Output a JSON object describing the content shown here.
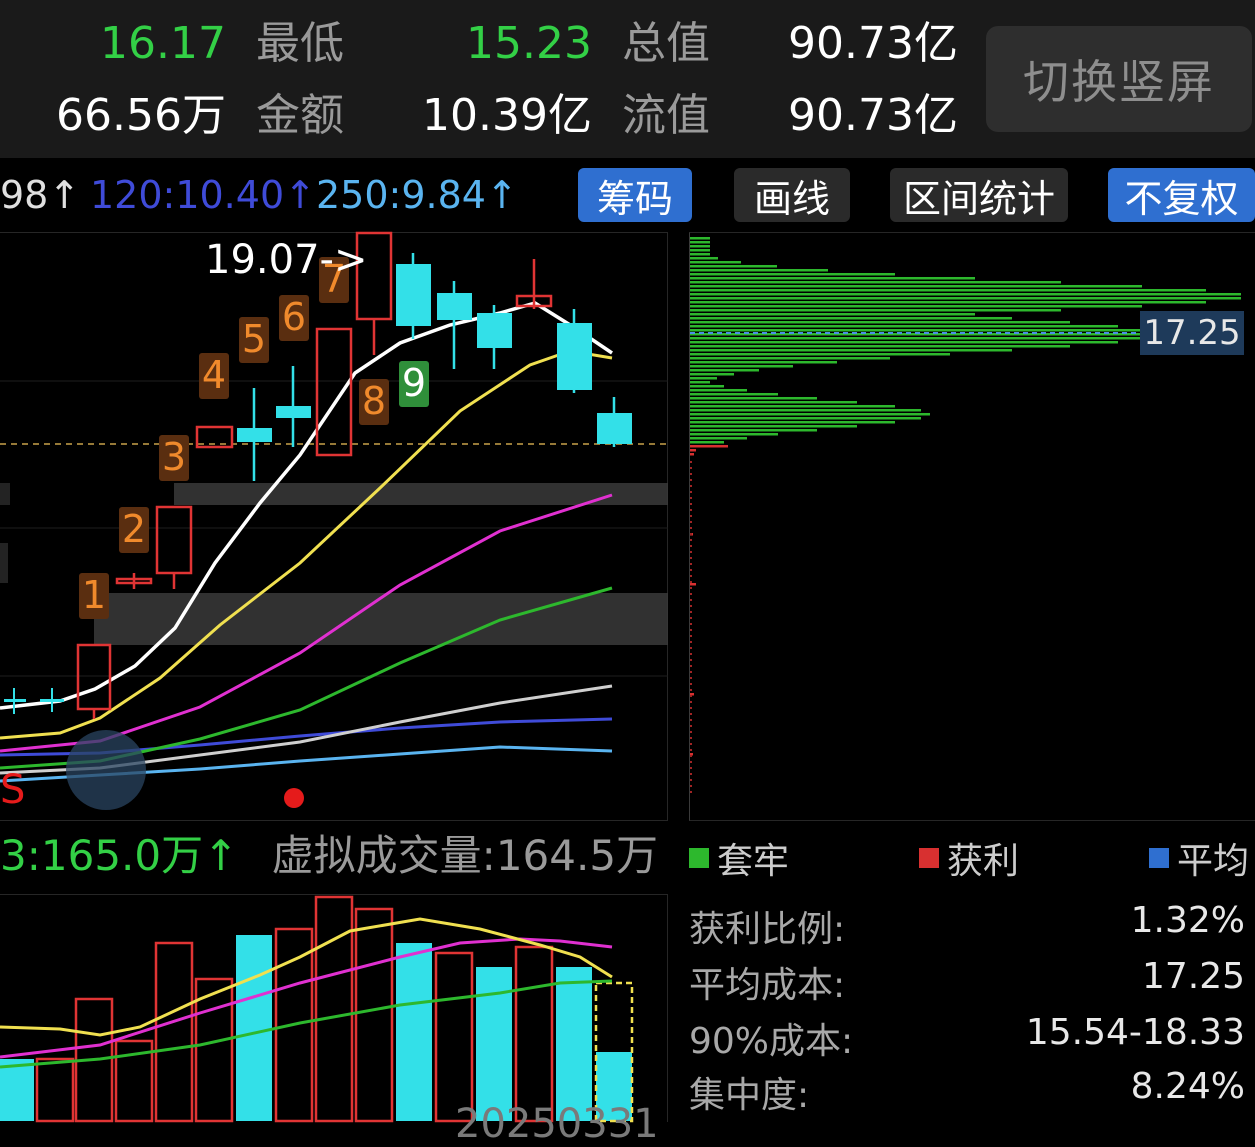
{
  "header": {
    "row1": [
      {
        "value": "16.17",
        "label": "最低",
        "value2": "15.23",
        "label2": "总值",
        "value3": "90.73亿"
      },
      {
        "value": "66.56万",
        "label": "金额",
        "value2": "10.39亿",
        "label2": "流值",
        "value3": "90.73亿"
      }
    ],
    "switch_label": "切换竖屏"
  },
  "ma": [
    {
      "text": "98↑",
      "color": "#e0e0e0"
    },
    {
      "text": "120:10.40↑",
      "color": "#3f4bd8"
    },
    {
      "text": "250:9.84↑",
      "color": "#5ab4f0"
    }
  ],
  "toolbar": {
    "chips_label": "筹码",
    "draw_label": "画线",
    "range_label": "区间统计",
    "adjust_label": "不复权",
    "chips_color": "#2f6fd0",
    "adjust_color": "#2f6fd0"
  },
  "kline": {
    "high_annotation": "19.07->",
    "td_count": [
      "1",
      "2",
      "3",
      "4",
      "5",
      "6",
      "7",
      "8",
      "9"
    ],
    "signal_label": "S"
  },
  "chip": {
    "avg_price_label": "17.25"
  },
  "volume": {
    "left_text": "3:165.0万↑",
    "virtual_label": "虚拟成交量:164.5万"
  },
  "legend": {
    "trapped": "套牢",
    "profit": "获利",
    "average": "平均",
    "trapped_color": "#2db82d",
    "profit_color": "#d83030",
    "average_color": "#2f6fd0"
  },
  "stats": [
    {
      "key": "获利比例:",
      "value": "1.32%"
    },
    {
      "key": "平均成本:",
      "value": "17.25"
    },
    {
      "key": "90%成本:",
      "value": "15.54-18.33"
    },
    {
      "key": "集中度:",
      "value": "8.24%"
    }
  ],
  "date_label": "20250331"
}
